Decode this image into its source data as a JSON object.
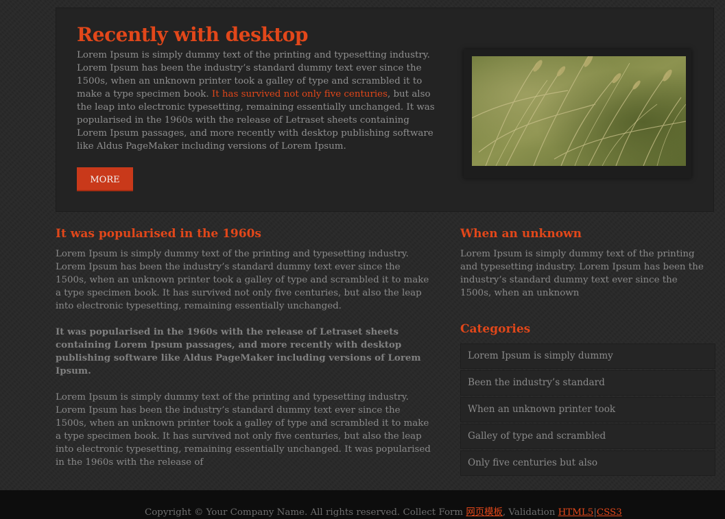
{
  "hero": {
    "title": "Recently with desktop",
    "text_before": "Lorem Ipsum is simply dummy text of the printing and typesetting industry. Lorem Ipsum has been the industry’s standard dummy text ever since the 1500s, when an unknown printer took a galley of type and scrambled it to make a type specimen book. ",
    "highlight": "It has survived not only five centuries",
    "text_after": ", but also the leap into electronic typesetting, remaining essentially unchanged. It was popularised in the 1960s with the release of Letraset sheets containing Lorem Ipsum passages, and more recently with desktop publishing software like Aldus PageMaker including versions of Lorem Ipsum.",
    "more_label": "MORE",
    "image": "wheat-field-photo"
  },
  "left": {
    "title": "It was popularised in the 1960s",
    "para1": "Lorem Ipsum is simply dummy text of the printing and typesetting industry. Lorem Ipsum has been the industry’s standard dummy text ever since the 1500s, when an unknown printer took a galley of type and scrambled it to make a type specimen book. It has survived not only five centuries, but also the leap into electronic typesetting, remaining essentially unchanged.",
    "para2": "It was popularised in the 1960s with the release of Letraset sheets containing Lorem Ipsum passages, and more recently with desktop publishing software like Aldus PageMaker including versions of Lorem Ipsum.",
    "para3": "Lorem Ipsum is simply dummy text of the printing and typesetting industry. Lorem Ipsum has been the industry’s standard dummy text ever since the 1500s, when an unknown printer took a galley of type and scrambled it to make a type specimen book. It has survived not only five centuries, but also the leap into electronic typesetting, remaining essentially unchanged. It was popularised in the 1960s with the release of"
  },
  "right": {
    "title": "When an unknown",
    "para": "Lorem Ipsum is simply dummy text of the printing and typesetting industry. Lorem Ipsum has been the industry’s standard dummy text ever since the 1500s, when an unknown",
    "categories_title": "Categories",
    "categories": [
      "Lorem Ipsum is simply dummy",
      "Been the industry’s standard",
      "When an unknown printer took",
      "Galley of type and scrambled",
      "Only five centuries but also"
    ]
  },
  "footer": {
    "copyright": "Copyright © Your Company Name. All rights reserved. Collect Form ",
    "link_template": "网页模板",
    "validation": ", Validation ",
    "link_html5": "HTML5",
    "separator": "|",
    "link_css3": "CSS3"
  },
  "colors": {
    "accent": "#e2471a",
    "background": "#282828",
    "footer_bg": "#0d0d0d",
    "text": "#8a8a8a"
  }
}
